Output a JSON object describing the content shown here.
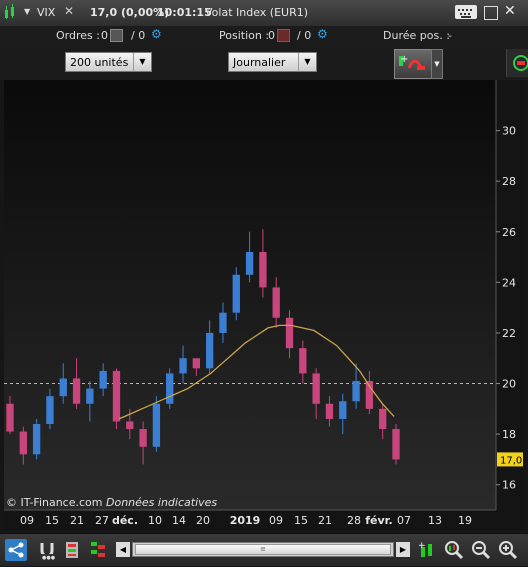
{
  "titlebar": {
    "symbol": "VIX",
    "price": "17,0 (0,00%)",
    "time": "10:01:15",
    "name": "Volat Index (EUR1)"
  },
  "orderbar": {
    "orders_label": "Ordres :",
    "orders_value": "0",
    "orders_slash_value": "/ 0",
    "position_label": "Position :",
    "position_value": "0",
    "position_slash_value": "/ 0",
    "duration_label": "Durée pos. :",
    "duration_value": "-"
  },
  "controls": {
    "units_selected": "200 unités",
    "period_selected": "Journalier"
  },
  "chart_data": {
    "type": "candlestick",
    "ylim": [
      15,
      32
    ],
    "y_ticks": [
      16,
      18,
      20,
      22,
      24,
      26,
      28,
      30
    ],
    "x_tick_labels": [
      "09",
      "15",
      "21",
      "27",
      "déc.",
      "10",
      "14",
      "20",
      "2019",
      "09",
      "15",
      "21",
      "28",
      "févr.",
      "07",
      "13",
      "19"
    ],
    "reference_level": 20,
    "last_price_label": "17,0",
    "watermark": "© IT-Finance.com",
    "watermark_note": "Données indicatives",
    "moving_average": [
      18.6,
      18.8,
      19.0,
      19.2,
      19.4,
      19.6,
      19.8,
      20.1,
      20.4,
      20.8,
      21.2,
      21.6,
      21.9,
      22.2,
      22.3,
      22.3,
      22.2,
      22.1,
      21.8,
      21.5,
      21.0,
      20.5,
      19.8,
      19.2,
      18.7
    ],
    "candles": [
      {
        "o": 19.2,
        "h": 19.5,
        "l": 18.0,
        "c": 18.1
      },
      {
        "o": 18.1,
        "h": 18.3,
        "l": 16.8,
        "c": 17.2
      },
      {
        "o": 17.2,
        "h": 18.6,
        "l": 17.0,
        "c": 18.4
      },
      {
        "o": 18.4,
        "h": 19.8,
        "l": 18.2,
        "c": 19.5
      },
      {
        "o": 19.5,
        "h": 20.8,
        "l": 19.2,
        "c": 20.2
      },
      {
        "o": 20.2,
        "h": 21.0,
        "l": 19.0,
        "c": 19.2
      },
      {
        "o": 19.2,
        "h": 20.1,
        "l": 18.5,
        "c": 19.8
      },
      {
        "o": 19.8,
        "h": 20.8,
        "l": 19.5,
        "c": 20.5
      },
      {
        "o": 20.5,
        "h": 20.6,
        "l": 18.2,
        "c": 18.5
      },
      {
        "o": 18.5,
        "h": 19.0,
        "l": 17.8,
        "c": 18.2
      },
      {
        "o": 18.2,
        "h": 18.5,
        "l": 16.8,
        "c": 17.5
      },
      {
        "o": 17.5,
        "h": 19.5,
        "l": 17.3,
        "c": 19.2
      },
      {
        "o": 19.2,
        "h": 20.6,
        "l": 19.0,
        "c": 20.4
      },
      {
        "o": 20.4,
        "h": 21.5,
        "l": 20.0,
        "c": 21.0
      },
      {
        "o": 21.0,
        "h": 20.8,
        "l": 20.3,
        "c": 20.6
      },
      {
        "o": 20.6,
        "h": 22.5,
        "l": 20.4,
        "c": 22.0
      },
      {
        "o": 22.0,
        "h": 23.2,
        "l": 21.6,
        "c": 22.8
      },
      {
        "o": 22.8,
        "h": 24.6,
        "l": 22.5,
        "c": 24.3
      },
      {
        "o": 24.3,
        "h": 26.0,
        "l": 24.0,
        "c": 25.2
      },
      {
        "o": 25.2,
        "h": 26.1,
        "l": 23.4,
        "c": 23.8
      },
      {
        "o": 23.8,
        "h": 24.2,
        "l": 22.2,
        "c": 22.6
      },
      {
        "o": 22.6,
        "h": 22.9,
        "l": 21.0,
        "c": 21.4
      },
      {
        "o": 21.4,
        "h": 21.7,
        "l": 20.0,
        "c": 20.4
      },
      {
        "o": 20.4,
        "h": 20.6,
        "l": 18.6,
        "c": 19.2
      },
      {
        "o": 19.2,
        "h": 19.5,
        "l": 18.3,
        "c": 18.6
      },
      {
        "o": 18.6,
        "h": 19.6,
        "l": 18.0,
        "c": 19.3
      },
      {
        "o": 19.3,
        "h": 20.8,
        "l": 19.0,
        "c": 20.1
      },
      {
        "o": 20.1,
        "h": 20.5,
        "l": 18.8,
        "c": 19.0
      },
      {
        "o": 19.0,
        "h": 19.2,
        "l": 17.8,
        "c": 18.2
      },
      {
        "o": 18.2,
        "h": 18.4,
        "l": 16.8,
        "c": 17.0
      }
    ]
  },
  "colors": {
    "up": "#3b7fd4",
    "down": "#c8457e",
    "ma": "#c9a54a",
    "background": "#0c0c0c",
    "price_tag": "#f2d21b"
  },
  "toolbar_icons": [
    "share-icon",
    "magnet-icon",
    "candles-icon",
    "bars-icon",
    "scroll-left-icon",
    "scroll-right-icon",
    "add-indicator-icon",
    "zoom-fit-icon",
    "zoom-out-icon",
    "zoom-in-icon"
  ]
}
